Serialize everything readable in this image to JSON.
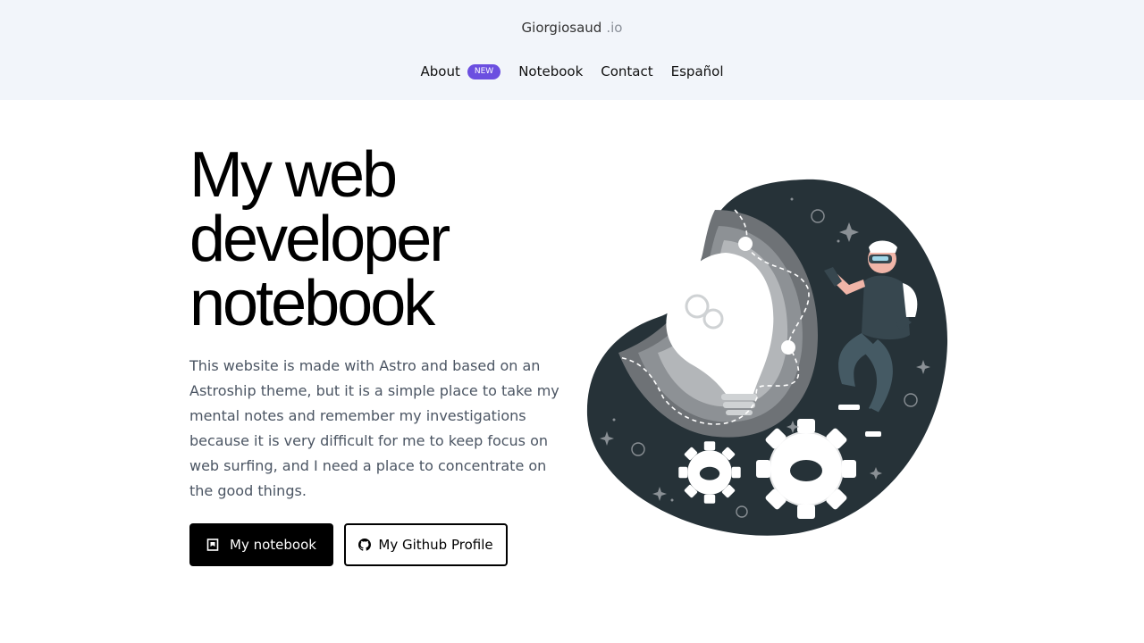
{
  "header": {
    "brand_name": "Giorgiosaud",
    "brand_tld": ".io",
    "nav": [
      {
        "label": "About",
        "badge": "NEW"
      },
      {
        "label": "Notebook"
      },
      {
        "label": "Contact"
      },
      {
        "label": "Español"
      }
    ]
  },
  "hero": {
    "title_line1": "My web",
    "title_line2": "developer",
    "title_line3": "notebook",
    "description": "This website is made with Astro and based on an Astroship theme, but it is a simple place to take my mental notes and remember my investigations because it is very difficult for me to keep focus on web surfing, and I need a place to concentrate on the good things.",
    "primary_button": "My notebook",
    "secondary_button": "My Github Profile",
    "primary_icon": "notebook-icon",
    "secondary_icon": "github-icon"
  },
  "colors": {
    "header_bg": "#f2f5fa",
    "badge_bg": "#6b4fe0",
    "illustration_dark": "#263238"
  }
}
